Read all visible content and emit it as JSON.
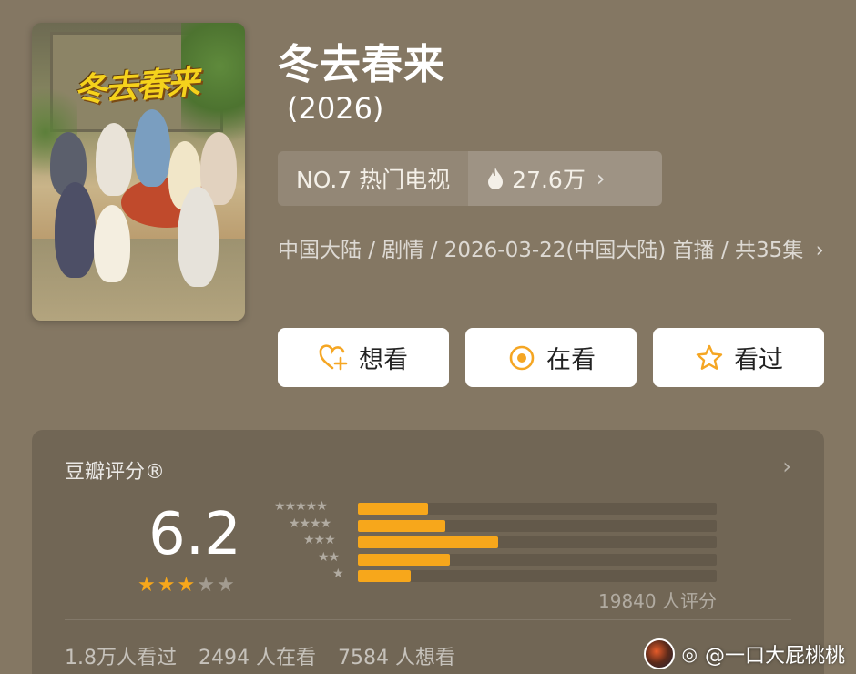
{
  "show": {
    "title": "冬去春来",
    "year": "(2026)",
    "poster_title_art": "冬去春来"
  },
  "rank": {
    "label": "NO.7 热门电视",
    "heat": "27.6万"
  },
  "meta": {
    "line": "中国大陆 / 剧情 / 2026-03-22(中国大陆) 首播 / 共35集"
  },
  "actions": {
    "want": "想看",
    "watching": "在看",
    "watched": "看过"
  },
  "rating": {
    "title": "豆瓣评分®",
    "score": "6.2",
    "stars_filled": 3,
    "stars_total": 5,
    "distribution": [
      {
        "stars": 5,
        "fraction": 0.16
      },
      {
        "stars": 4,
        "fraction": 0.2
      },
      {
        "stars": 3,
        "fraction": 0.32
      },
      {
        "stars": 2,
        "fraction": 0.21
      },
      {
        "stars": 1,
        "fraction": 0.12
      }
    ],
    "count": "19840 人评分",
    "watched": "1.8万人看过",
    "watching": "2494 人在看",
    "want": "7584 人想看"
  },
  "colors": {
    "background": "#847763",
    "accent": "#f7a71b",
    "button_icon": "#f5a623"
  },
  "watermark": {
    "text": "@一口大屁桃桃"
  }
}
